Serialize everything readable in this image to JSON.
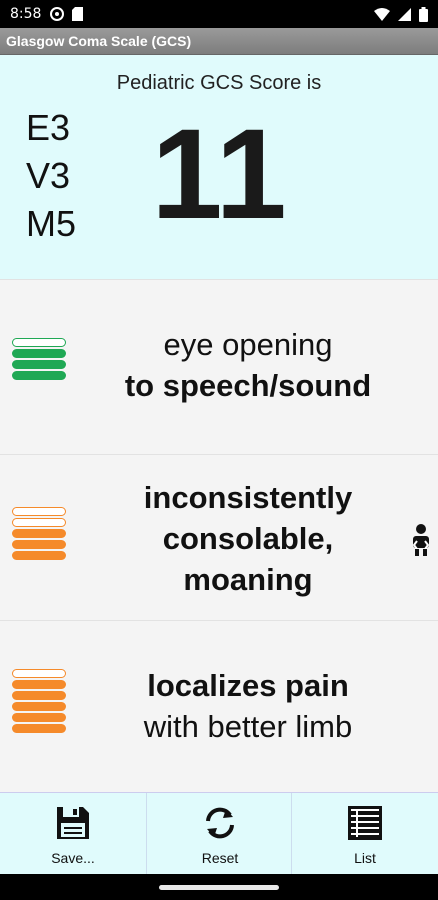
{
  "status_bar": {
    "time": "8:58"
  },
  "title_bar": {
    "title": "Glasgow Coma Scale (GCS)"
  },
  "score_panel": {
    "heading": "Pediatric GCS Score is",
    "eye": "E3",
    "verbal": "V3",
    "motor": "M5",
    "total": "11"
  },
  "rows": {
    "eye": {
      "line1": "eye opening",
      "line2": "to speech/sound",
      "level": 3,
      "max": 4,
      "color": "#1fa854"
    },
    "verbal": {
      "line1": "inconsistently",
      "line2": "consolable,",
      "line3": "moaning",
      "level": 3,
      "max": 5,
      "color": "#f58a2a"
    },
    "motor": {
      "line1": "localizes pain",
      "line2": "with better limb",
      "level": 5,
      "max": 6,
      "color": "#f58a2a"
    }
  },
  "toolbar": {
    "save_label": "Save...",
    "reset_label": "Reset",
    "list_label": "List"
  },
  "icons": {
    "save": "floppy-disk-icon",
    "reset": "refresh-icon",
    "list": "list-icon",
    "child": "child-icon"
  }
}
